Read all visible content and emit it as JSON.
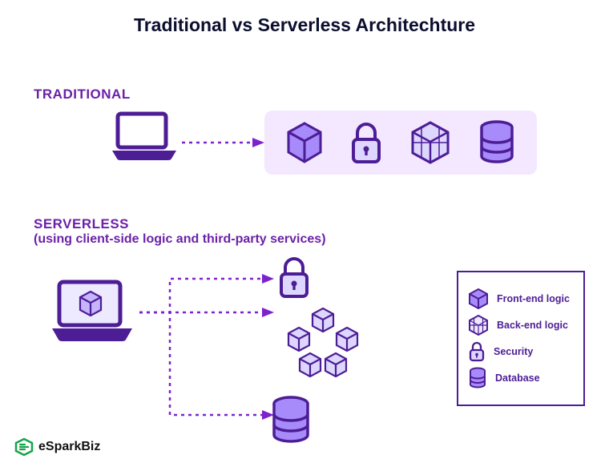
{
  "title": "Traditional vs Serverless Architechture",
  "sections": {
    "traditional": {
      "label": "TRADITIONAL"
    },
    "serverless": {
      "label": "SERVERLESS",
      "sub": "(using client-side logic and third-party services)"
    }
  },
  "legend": {
    "items": [
      {
        "key": "front_end",
        "label": "Front-end logic"
      },
      {
        "key": "back_end",
        "label": "Back-end logic"
      },
      {
        "key": "security",
        "label": "Security"
      },
      {
        "key": "database",
        "label": "Database"
      }
    ]
  },
  "brand": "eSparkBiz",
  "colors": {
    "outline": "#4c1d95",
    "fill_light": "#ddd6fe",
    "fill_mid": "#a78bfa",
    "accent_green": "#16a34a",
    "bg_panel": "#f3e8ff"
  },
  "icons": {
    "laptop": "laptop-icon",
    "front_end": "cube-icon",
    "back_end": "wireframe-cube-icon",
    "security": "lock-icon",
    "database": "database-icon",
    "cluster": "cube-cluster-icon"
  }
}
